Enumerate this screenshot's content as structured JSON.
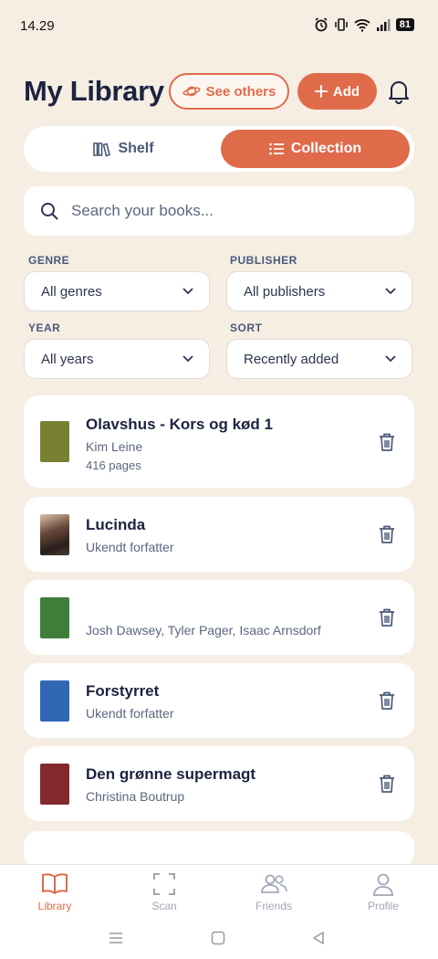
{
  "status_bar": {
    "time": "14.29",
    "battery": "81"
  },
  "header": {
    "title": "My Library",
    "see_others_label": "See others",
    "add_label": "Add"
  },
  "view_toggle": {
    "shelf_label": "Shelf",
    "collection_label": "Collection",
    "active": "Collection"
  },
  "search": {
    "placeholder": "Search your books..."
  },
  "filters": {
    "genre": {
      "label": "GENRE",
      "value": "All genres"
    },
    "publisher": {
      "label": "PUBLISHER",
      "value": "All publishers"
    },
    "year": {
      "label": "YEAR",
      "value": "All years"
    },
    "sort": {
      "label": "SORT",
      "value": "Recently added"
    }
  },
  "books": [
    {
      "title": "Olavshus - Kors og kød 1",
      "author": "Kim Leine",
      "pages": "416 pages",
      "cover_color": "#7a8032"
    },
    {
      "title": "Lucinda",
      "author": "Ukendt forfatter",
      "cover_color": "#3a2c2a"
    },
    {
      "title": "",
      "author": "Josh Dawsey, Tyler Pager, Isaac Arnsdorf",
      "cover_color": "#3f7d3a"
    },
    {
      "title": "Forstyrret",
      "author": "Ukendt forfatter",
      "cover_color": "#3168b6"
    },
    {
      "title": "Den grønne supermagt",
      "author": "Christina Boutrup",
      "cover_color": "#84292b"
    }
  ],
  "bottom_nav": [
    {
      "label": "Library",
      "icon": "book-open-icon",
      "active": true
    },
    {
      "label": "Scan",
      "icon": "scan-icon",
      "active": false
    },
    {
      "label": "Friends",
      "icon": "friends-icon",
      "active": false
    },
    {
      "label": "Profile",
      "icon": "profile-icon",
      "active": false
    }
  ],
  "colors": {
    "accent": "#df6b4b",
    "background": "#f6ede3",
    "text": "#1c2340"
  }
}
